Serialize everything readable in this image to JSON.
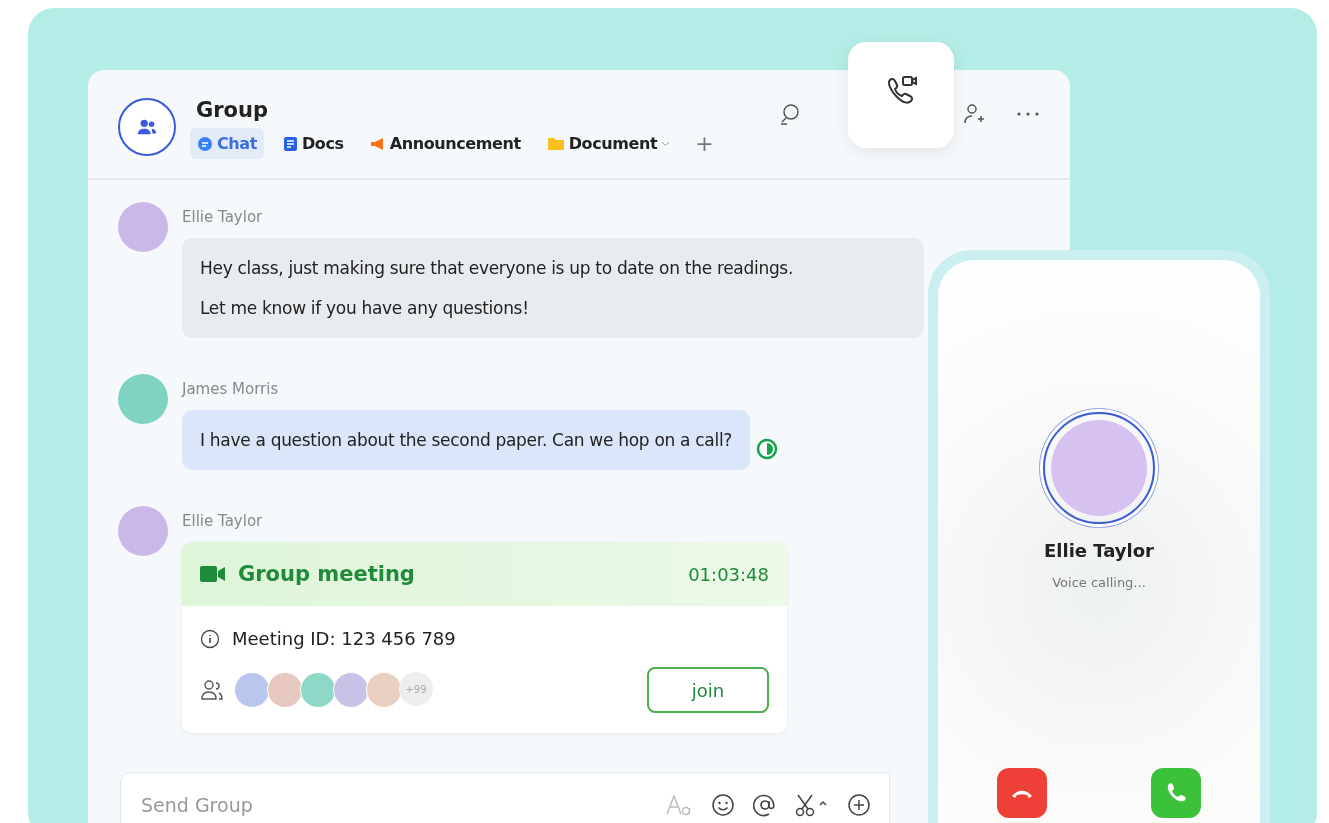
{
  "header": {
    "title": "Group"
  },
  "tabs": [
    {
      "label": "Chat",
      "kind": "chat",
      "selected": true
    },
    {
      "label": "Docs",
      "kind": "docs",
      "selected": false
    },
    {
      "label": "Announcement",
      "kind": "announcement",
      "selected": false
    },
    {
      "label": "Document",
      "kind": "document",
      "selected": false
    }
  ],
  "add_tab": "+",
  "messages": [
    {
      "sender": "Ellie Taylor",
      "kind": "text",
      "color": "#e9ecef",
      "text": "Hey class, just making sure that everyone is up to date on the readings.\n Let me know if you have any questions!"
    },
    {
      "sender": "James Morris",
      "kind": "text",
      "color": "#dbe6fb",
      "text": "I have a question about the second paper. Can we hop on a call?"
    },
    {
      "sender": "Ellie Taylor",
      "kind": "meeting",
      "title": "Group meeting",
      "time": "01:03:48",
      "meeting_id": "Meeting ID: 123 456 789",
      "more_participants": "+99",
      "join": "join"
    }
  ],
  "composer": {
    "placeholder": "Send Group"
  },
  "call": {
    "name": "Ellie Taylor",
    "status": "Voice calling..."
  }
}
